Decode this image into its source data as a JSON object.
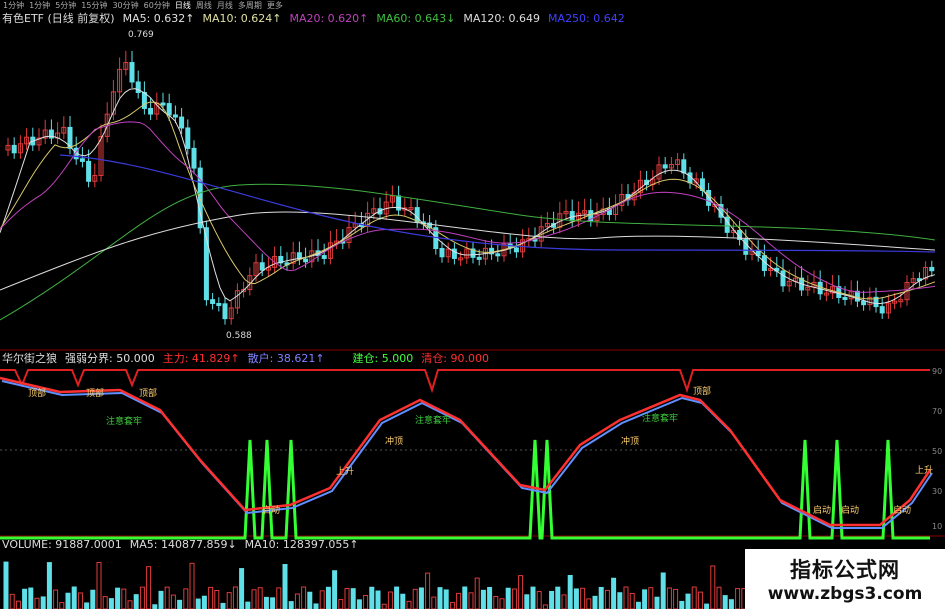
{
  "period_bar": {
    "items": [
      "1分钟",
      "1分钟",
      "5分钟",
      "15分钟",
      "30分钟",
      "60分钟",
      "日线",
      "周线",
      "月线",
      "多周期",
      "更多"
    ]
  },
  "kline_legend": {
    "title": "有色ETF (日线 前复权)",
    "ma5": "MA5: 0.632↑",
    "ma10": "MA10: 0.624↑",
    "ma20": "MA20: 0.620↑",
    "ma60": "MA60: 0.643↓",
    "ma120": "MA120: 0.649",
    "ma250": "MA250: 0.642",
    "high_label": "0.769",
    "low_label": "0.588"
  },
  "indicator_legend": {
    "name": "华尔街之狼",
    "param": "强弱分界: 50.000",
    "main": "主力: 41.829↑",
    "retail": "散户: 38.621↑",
    "build": "建仓: 5.000",
    "clear": "清仓: 90.000"
  },
  "indicator_labels": {
    "top1": "顶部",
    "top2": "顶部",
    "top3": "顶部",
    "top4": "顶部",
    "care1": "注意套牢",
    "care2": "注意套牢",
    "care3": "注意套牢",
    "surge1": "冲顶",
    "surge2": "冲顶",
    "rise1": "上升",
    "rise2": "上升",
    "start1": "启动",
    "start2": "启动",
    "start3": "启动",
    "start4": "启动",
    "axis": [
      "90",
      "70",
      "50",
      "30",
      "10"
    ]
  },
  "volume_legend": {
    "volume": "VOLUME: 91887.0001",
    "ma5": "MA5: 140877.859↓",
    "ma10": "MA10: 128397.055↑"
  },
  "watermark": {
    "title": "指标公式网",
    "url": "www.zbgs3.com"
  },
  "colors": {
    "up": "#e03b3b",
    "down": "#5fe0e8",
    "ma5": "#e0e0e0",
    "ma10": "#d8c86a",
    "ma20": "#c040c0",
    "ma60": "#40b040",
    "ma120": "#dddddd",
    "ma250": "#3b3bdc",
    "main_line": "#ff3030",
    "retail_line": "#6090ff",
    "signal": "#33ff33"
  }
}
